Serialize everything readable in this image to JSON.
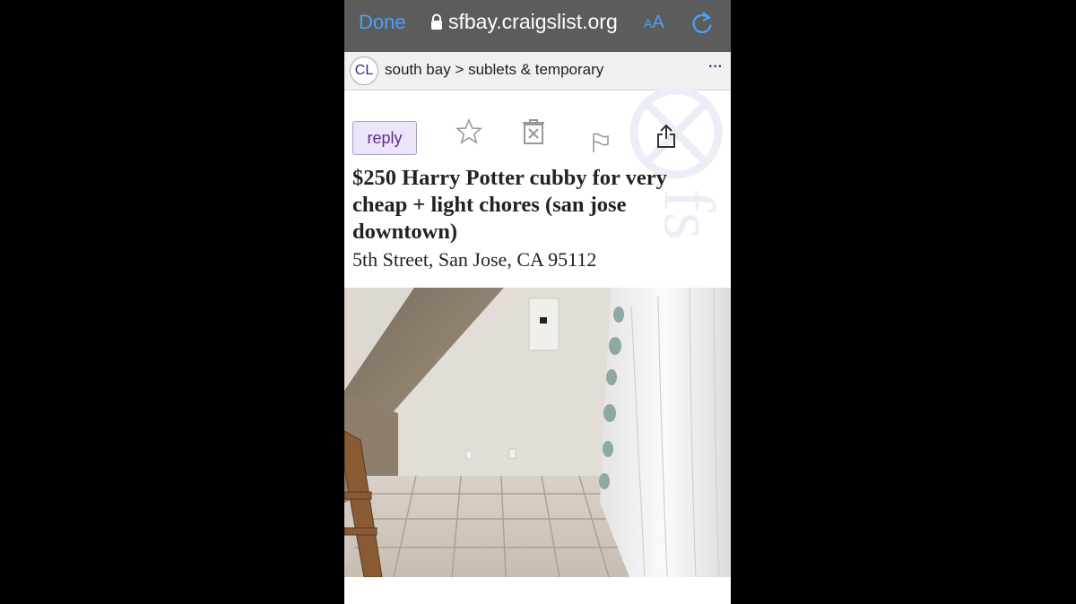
{
  "browser": {
    "done_label": "Done",
    "url": "sfbay.craigslist.org",
    "text_size_label": "AA",
    "lock_icon": "lock-icon",
    "reload_icon": "reload-icon",
    "accent_color": "#4ea0f7"
  },
  "site_bar": {
    "logo_text": "CL",
    "breadcrumb": "south bay > sublets & temporary",
    "more_label": "···"
  },
  "actions": {
    "reply_label": "reply",
    "icons": [
      "star-icon",
      "hide-icon",
      "flag-icon",
      "share-icon"
    ]
  },
  "posting": {
    "title": "$250 Harry Potter cubby for very cheap + light chores (san jose downtown)",
    "address": "5th Street, San Jose, CA 95112"
  },
  "photo": {
    "icon": "listing-photo",
    "description_hidden": true
  }
}
